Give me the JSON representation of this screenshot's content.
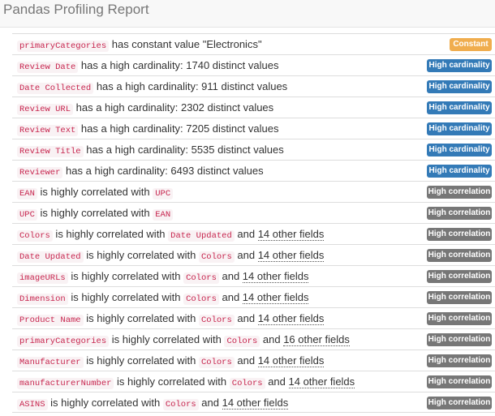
{
  "header": {
    "title": "Pandas Profiling Report"
  },
  "rows": [
    {
      "field": "primaryCategories",
      "text": " has constant value \"Electronics\"",
      "badge": "Constant"
    },
    {
      "field": "Review Date",
      "text": " has a high cardinality: 1740 distinct values",
      "badge": "High cardinality"
    },
    {
      "field": "Date Collected",
      "text": " has a high cardinality: 911 distinct values",
      "badge": "High cardinality"
    },
    {
      "field": "Review URL",
      "text": " has a high cardinality: 2302 distinct values",
      "badge": "High cardinality"
    },
    {
      "field": "Review Text",
      "text": " has a high cardinality: 7205 distinct values",
      "badge": "High cardinality"
    },
    {
      "field": "Review Title",
      "text": " has a high cardinality: 5535 distinct values",
      "badge": "High cardinality"
    },
    {
      "field": "Reviewer",
      "text": " has a high cardinality: 6493 distinct values",
      "badge": "High cardinality"
    },
    {
      "field": "EAN",
      "text": " is highly correlated with ",
      "corr": "UPC",
      "badge": "High correlation"
    },
    {
      "field": "UPC",
      "text": " is highly correlated with ",
      "corr": "EAN",
      "badge": "High correlation"
    },
    {
      "field": "Colors",
      "text": " is highly correlated with ",
      "corr": "Date Updated",
      "and": " and ",
      "others": "14 other fields",
      "badge": "High correlation"
    },
    {
      "field": "Date Updated",
      "text": " is highly correlated with ",
      "corr": "Colors",
      "and": " and ",
      "others": "14 other fields",
      "badge": "High correlation"
    },
    {
      "field": "imageURLs",
      "text": " is highly correlated with ",
      "corr": "Colors",
      "and": " and ",
      "others": "14 other fields",
      "badge": "High correlation"
    },
    {
      "field": "Dimension",
      "text": " is highly correlated with ",
      "corr": "Colors",
      "and": " and ",
      "others": "14 other fields",
      "badge": "High correlation"
    },
    {
      "field": "Product Name",
      "text": " is highly correlated with ",
      "corr": "Colors",
      "and": " and ",
      "others": "14 other fields",
      "badge": "High correlation"
    },
    {
      "field": "primaryCategories",
      "text": " is highly correlated with ",
      "corr": "Colors",
      "and": " and ",
      "others": "16 other fields",
      "badge": "High correlation"
    },
    {
      "field": "Manufacturer",
      "text": " is highly correlated with ",
      "corr": "Colors",
      "and": " and ",
      "others": "14 other fields",
      "badge": "High correlation"
    },
    {
      "field": "manufacturerNumber",
      "text": " is highly correlated with ",
      "corr": "Colors",
      "and": " and ",
      "others": "14 other fields",
      "badge": "High correlation"
    },
    {
      "field": "ASINS",
      "text": " is highly correlated with ",
      "corr": "Colors",
      "and": " and ",
      "others": "14 other fields",
      "badge": "High correlation"
    }
  ],
  "colors": {
    "constant": "#f0ad4e",
    "cardinality": "#337ab7",
    "correlation": "#777777"
  }
}
